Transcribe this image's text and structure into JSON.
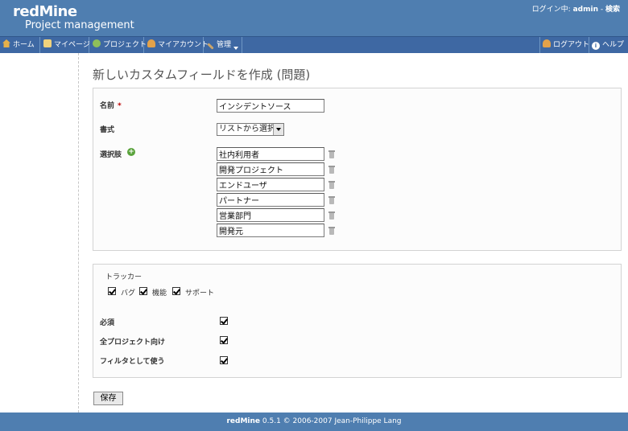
{
  "header": {
    "logo": "redMine",
    "subtitle": "Project management",
    "logged_as_prefix": "ログイン中:",
    "user": "admin",
    "separator": "-",
    "search_link": "検索"
  },
  "menu": {
    "home": "ホーム",
    "my_page": "マイページ",
    "projects": "プロジェクト",
    "my_account": "マイアカウント",
    "administration": "管理",
    "logout": "ログアウト",
    "help": "ヘルプ"
  },
  "page": {
    "title": "新しいカスタムフィールドを作成 (問題)"
  },
  "form": {
    "name_label": "名前",
    "required_mark": "*",
    "name_value": "インシデントソース",
    "format_label": "書式",
    "format_value": "リストから選択",
    "values_label": "選択肢",
    "values": [
      "社内利用者",
      "開発プロジェクト",
      "エンドユーザ",
      "パートナー",
      "営業部門",
      "開発元"
    ],
    "tracker_legend": "トラッカー",
    "trackers": [
      {
        "label": "バグ",
        "checked": true
      },
      {
        "label": "機能",
        "checked": true
      },
      {
        "label": "サポート",
        "checked": true
      }
    ],
    "required_label": "必須",
    "required_checked": true,
    "for_all_label": "全プロジェクト向け",
    "for_all_checked": true,
    "filter_label": "フィルタとして使う",
    "filter_checked": true,
    "save_label": "保存"
  },
  "footer": {
    "app": "redMine",
    "text": "0.5.1 © 2006-2007 Jean-Philippe Lang"
  },
  "colors": {
    "header_bg": "#4f7eb0",
    "menu_bg": "#3e68a3",
    "required": "#bb0000"
  }
}
